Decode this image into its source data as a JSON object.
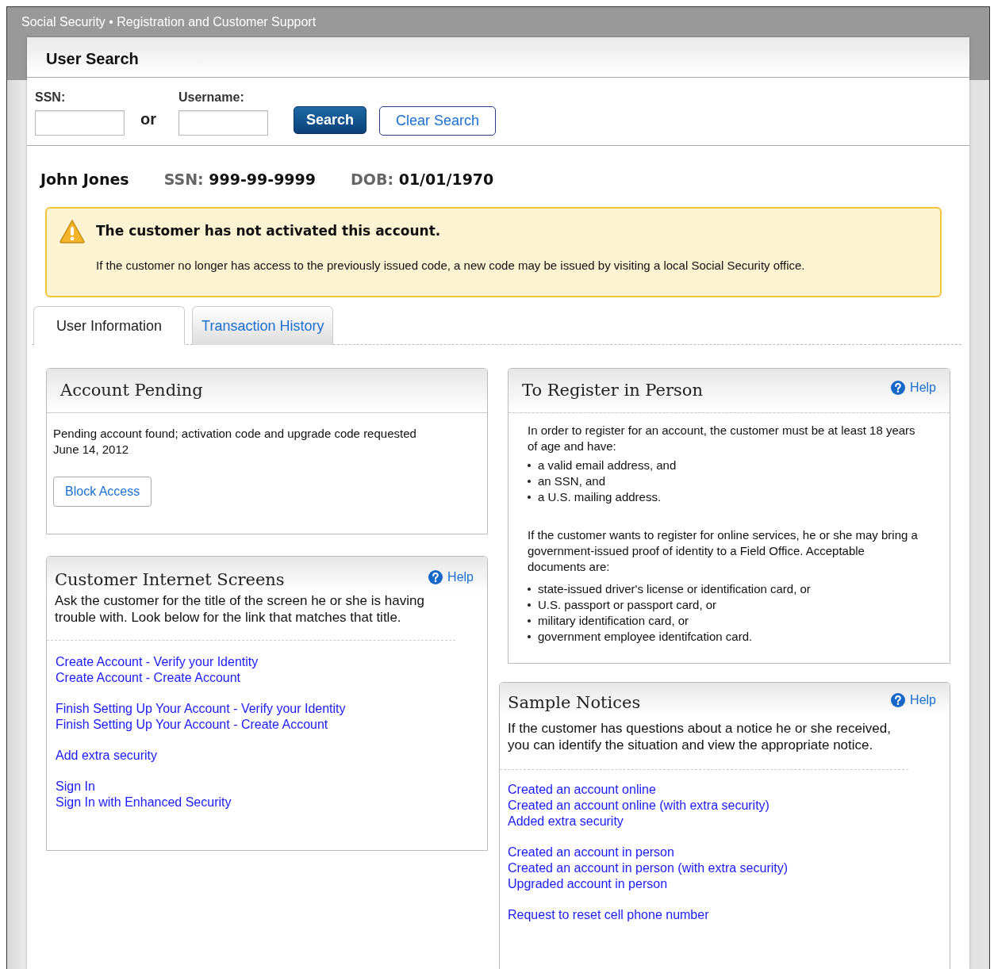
{
  "app_title": "Social Security • Registration and Customer Support",
  "search": {
    "title": "User Search",
    "fields": [
      {
        "label": "SSN:"
      },
      {
        "label": "Username:"
      }
    ],
    "separator": "or",
    "buttons": [
      {
        "label": "Search",
        "kind": "primary"
      },
      {
        "label": "Clear Search",
        "kind": "outline"
      }
    ]
  },
  "customer": {
    "name": "John Jones",
    "ssn_label": "SSN:",
    "ssn": "999-99-9999",
    "dob_label": "DOB:",
    "dob": "01/01/1970"
  },
  "alert": {
    "title": "The customer has not activated this account.",
    "message": "If the customer no longer has access to the previously issued code, a new code may be issued by visiting a local Social Security office."
  },
  "tabs": [
    {
      "label": "User Information",
      "selected": true
    },
    {
      "label": "Transaction History",
      "selected": false
    }
  ],
  "account_pending": {
    "title": "Account Pending",
    "text": "Pending account found; activation code and upgrade code requested June 14, 2012",
    "button": "Block Access"
  },
  "internet_screens": {
    "title": "Customer Internet Screens",
    "help": "Help",
    "intro": "Ask the customer for the title of the screen he or she is having trouble with. Look below for the link that matches that title.",
    "link_groups": [
      [
        "Create Account - Verify your Identity",
        "Create Account - Create Account"
      ],
      [
        "Finish Setting Up Your Account - Verify your Identity",
        "Finish Setting Up Your Account - Create Account"
      ],
      [
        "Add extra security"
      ],
      [
        "Sign In",
        "Sign In with Enhanced Security"
      ]
    ]
  },
  "register_in_person": {
    "title": "To Register in Person",
    "help": "Help",
    "intro": "In order to register for an account, the customer must be at least 18 years of age and have:",
    "requirements": [
      "a valid email address, and",
      "an SSN, and",
      "a U.S. mailing address."
    ],
    "documents_intro": "If the customer wants to register for online services, he or she may bring a government-issued proof of identity to a Field Office. Acceptable documents are:",
    "documents": [
      "state-issued driver's license or identification card, or",
      "U.S. passport or passport card, or",
      "military identification card, or",
      "government employee identifcation card."
    ]
  },
  "sample_notices": {
    "title": "Sample Notices",
    "help": "Help",
    "intro": "If the customer has questions about a notice he or she received, you can identify the situation and view the appropriate notice.",
    "link_groups": [
      [
        "Created an account online",
        "Created an account online (with extra security)",
        "Added extra security"
      ],
      [
        "Created an account in person",
        "Created an account in person (with extra security)",
        "Upgraded account in person"
      ],
      [
        "Request to reset cell phone number"
      ]
    ]
  }
}
